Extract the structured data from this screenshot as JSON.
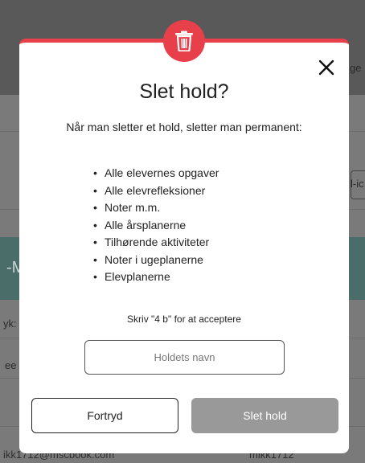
{
  "background": {
    "header_right_fragment": "ge",
    "field_fragment": "l-ic",
    "teal_fragment": "-M",
    "row_fragments": [
      "yk:",
      "ee"
    ],
    "bottom_left": "ikk1712@mscbook.com",
    "bottom_right": "mikk1712"
  },
  "dialog": {
    "icon": "trash-icon",
    "close_icon": "close-icon",
    "title": "Slet hold?",
    "subtitle": "Når man sletter et hold, sletter man permanent:",
    "items": [
      "Alle elevernes opgaver",
      "Alle elevrefleksioner",
      "Noter m.m.",
      "Alle årsplanerne",
      "Tilhørende aktiviteter",
      "Noter i ugeplanerne",
      "Elevplanerne"
    ],
    "accept_text": "Skriv \"4 b\" for at acceptere",
    "input_placeholder": "Holdets navn",
    "input_value": "",
    "cancel_label": "Fortryd",
    "delete_label": "Slet hold",
    "accent_color": "#e8404a",
    "delete_disabled_color": "#999999"
  }
}
